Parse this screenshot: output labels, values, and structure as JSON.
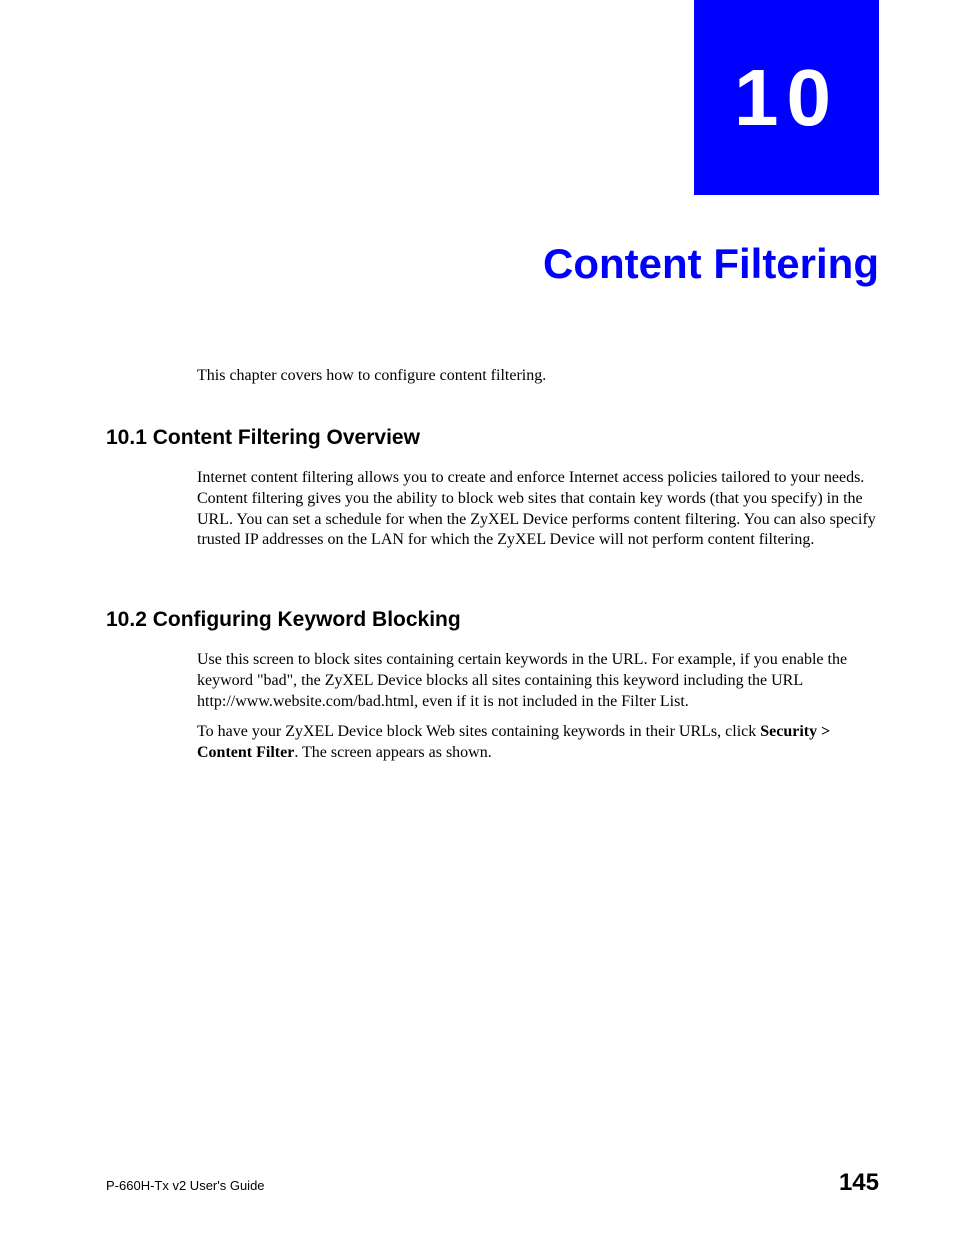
{
  "chapter": {
    "number": "10",
    "title": "Content Filtering",
    "intro": "This chapter covers how to configure content filtering."
  },
  "sections": {
    "s1": {
      "heading": "10.1  Content Filtering Overview",
      "body": "Internet content filtering allows you to create and enforce Internet access policies tailored to your needs. Content filtering gives you the ability to block web sites that contain key words (that you specify) in the URL. You can set a schedule for when the ZyXEL Device performs content filtering. You can also specify trusted IP addresses on the LAN for which the ZyXEL Device will not perform content filtering."
    },
    "s2": {
      "heading": "10.2  Configuring Keyword Blocking",
      "p1": "Use this screen to block sites containing certain keywords in the URL. For example, if you enable the keyword \"bad\", the ZyXEL Device blocks all sites containing this keyword including the URL http://www.website.com/bad.html, even if it is not included in the Filter List.",
      "p2_prefix": "To have your ZyXEL Device block Web sites containing keywords in their URLs, click ",
      "p2_bold": "Security > Content Filter",
      "p2_suffix": ". The screen appears as shown."
    }
  },
  "footer": {
    "guide": "P-660H-Tx v2 User's Guide",
    "page": "145"
  }
}
